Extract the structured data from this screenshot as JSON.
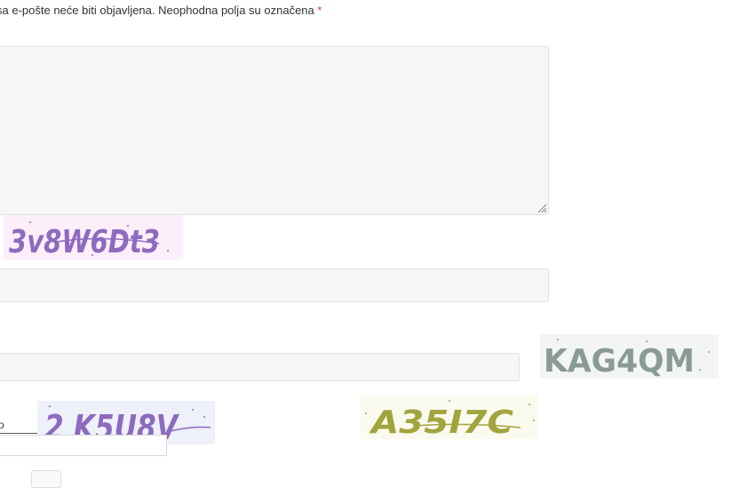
{
  "notice": {
    "text": "sa e-pošte neće biti objavljena. Neophodna polja su označena",
    "required_mark": "*"
  },
  "captchas": [
    {
      "name": "captcha-1",
      "text": "3v8W6Dt3",
      "color": "#8e6bbf",
      "background": "#fdeffa"
    },
    {
      "name": "captcha-2",
      "text": "KAG4QM",
      "color": "#8a9a96",
      "background": "#f2f5f4"
    },
    {
      "name": "captcha-3",
      "text": "2 K5U8V",
      "color": "#8c6bbd",
      "background": "#eef0fa"
    },
    {
      "name": "captcha-4",
      "text": "A35I7C",
      "color": "#a2a43d",
      "background": "#fbfaef"
    }
  ],
  "small_label": "o"
}
